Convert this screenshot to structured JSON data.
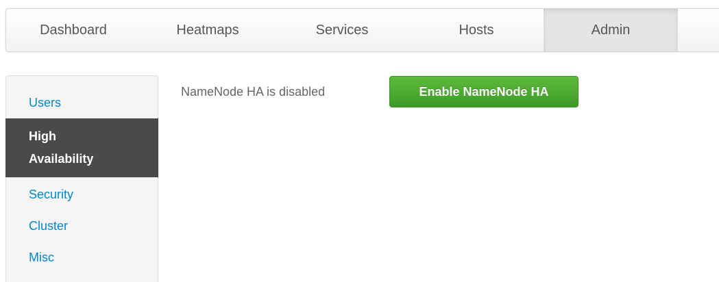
{
  "topnav": {
    "tabs": [
      {
        "label": "Dashboard",
        "active": false
      },
      {
        "label": "Heatmaps",
        "active": false
      },
      {
        "label": "Services",
        "active": false
      },
      {
        "label": "Hosts",
        "active": false
      },
      {
        "label": "Admin",
        "active": true
      }
    ]
  },
  "sidebar": {
    "items": [
      {
        "label": "Users",
        "active": false
      },
      {
        "label": "High Availability",
        "line1": "High",
        "line2": "Availability",
        "active": true
      },
      {
        "label": "Security",
        "active": false
      },
      {
        "label": "Cluster",
        "active": false
      },
      {
        "label": "Misc",
        "active": false
      }
    ]
  },
  "main": {
    "status_text": "NameNode HA is disabled",
    "enable_button_label": "Enable NameNode HA"
  },
  "colors": {
    "link": "#0088cc",
    "sidebar_active_bg": "#4a4a4a",
    "button_green": "#4aaa30"
  }
}
